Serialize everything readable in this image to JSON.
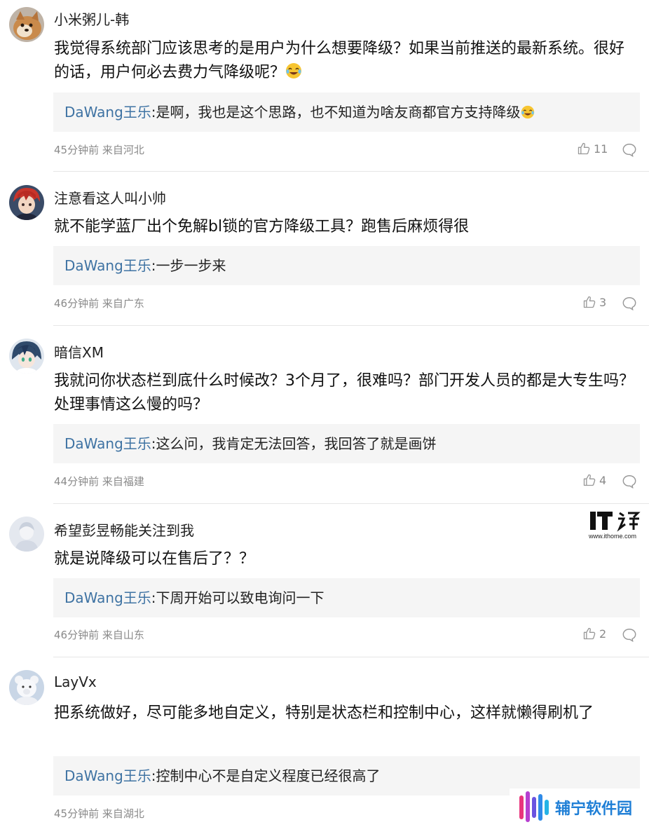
{
  "comments": [
    {
      "username": "小米粥儿-韩",
      "content": "我觉得系统部门应该思考的是用户为什么想要降级？如果当前推送的最新系统。很好的话，用户何必去费力气降级呢？",
      "reply_author": "DaWang王乐",
      "reply_text": ":是啊，我也是这个思路，也不知道为啥友商都官方支持降级",
      "time": "45分钟前",
      "location": "来自河北",
      "likes": "11",
      "avatar_icon": "shiba-dog-avatar"
    },
    {
      "username": "注意看这人叫小帅",
      "content": "就不能学蓝厂出个免解bl锁的官方降级工具？跑售后麻烦得很",
      "reply_author": "DaWang王乐",
      "reply_text": ":一步一步来",
      "time": "46分钟前",
      "location": "来自广东",
      "likes": "3",
      "avatar_icon": "anime-red-hair-avatar"
    },
    {
      "username": "暗信XM",
      "content": "我就问你状态栏到底什么时候改？3个月了，很难吗？部门开发人员的都是大专生吗？处理事情这么慢的吗？",
      "reply_author": "DaWang王乐",
      "reply_text": ":这么问，我肯定无法回答，我回答了就是画饼",
      "time": "44分钟前",
      "location": "来自福建",
      "likes": "4",
      "avatar_icon": "anime-blue-hair-avatar"
    },
    {
      "username": "希望彭昱畅能关注到我",
      "content": "就是说降级可以在售后了？？",
      "reply_author": "DaWang王乐",
      "reply_text": ":下周开始可以致电询问一下",
      "time": "46分钟前",
      "location": "来自山东",
      "likes": "2",
      "avatar_icon": "pale-figure-avatar"
    },
    {
      "username": "LayVx",
      "content": "把系统做好，尽可能多地自定义，特别是状态栏和控制中心，这样就懒得刷机了",
      "reply_author": "DaWang王乐",
      "reply_text": ":控制中心不是自定义程度已经很高了",
      "time": "45分钟前",
      "location": "来自湖北",
      "likes": "",
      "avatar_icon": "white-teddy-bear-avatar"
    }
  ],
  "watermarks": {
    "ithome_logo": "IT之家",
    "ithome_url": "www.ithome.com",
    "fuling_text": "辅宁软件园"
  },
  "colors": {
    "reply_author": "#3f73a3",
    "reply_background": "#f5f5f5",
    "meta_text": "#8a8a8a",
    "divider": "#e6e6e6",
    "fuling_brand": "#1f7fd6"
  }
}
